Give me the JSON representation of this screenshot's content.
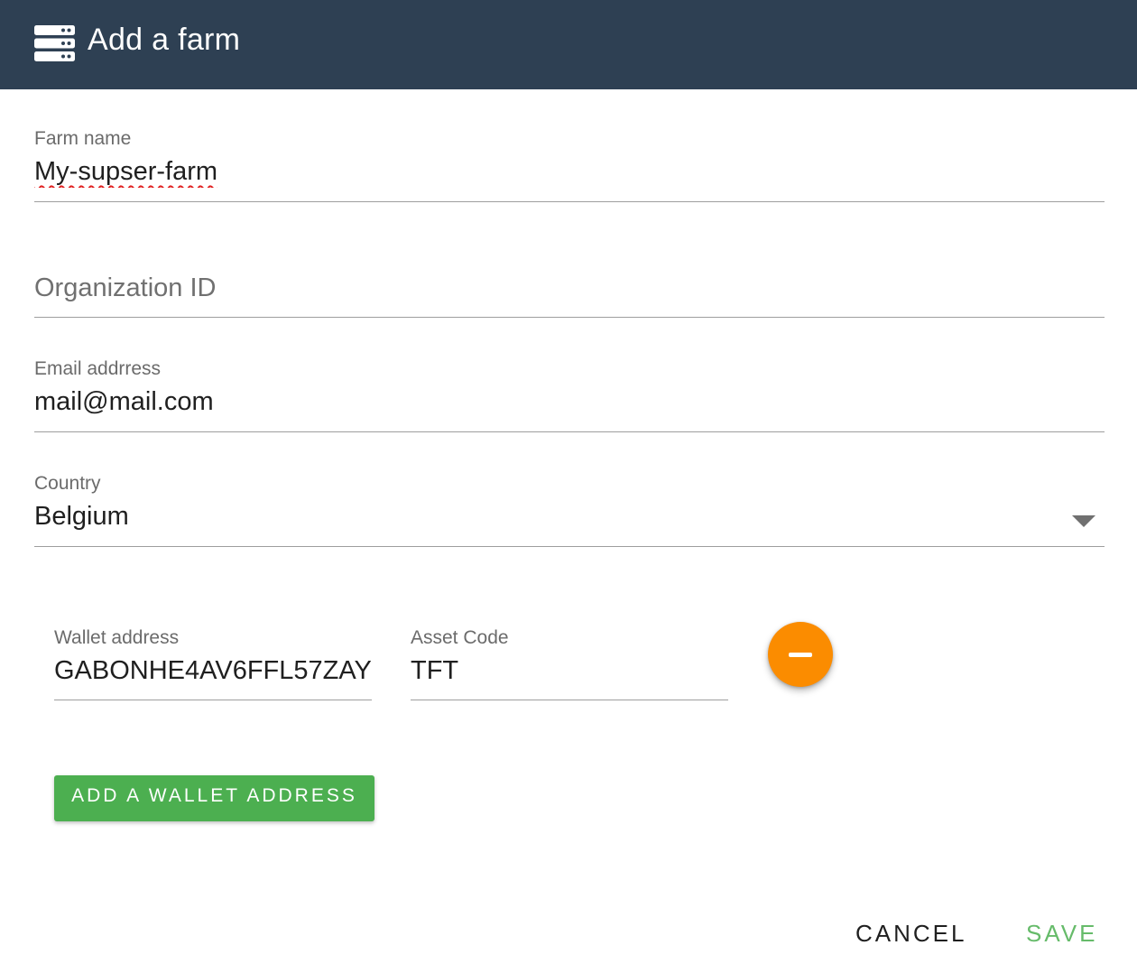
{
  "dialog": {
    "title": "Add a farm",
    "icon": "server-icon"
  },
  "form": {
    "farm_name": {
      "label": "Farm name",
      "value": "My-supser-farm"
    },
    "organization_id": {
      "placeholder": "Organization ID",
      "value": ""
    },
    "email": {
      "label": "Email addrress",
      "value": "mail@mail.com"
    },
    "country": {
      "label": "Country",
      "value": "Belgium"
    }
  },
  "wallets": [
    {
      "address_label": "Wallet address",
      "address_value": "GABONHE4AV6FFL57ZAY",
      "asset_label": "Asset Code",
      "asset_value": "TFT"
    }
  ],
  "buttons": {
    "add_wallet": "ADD A WALLET ADDRESS",
    "cancel": "CANCEL",
    "save": "SAVE",
    "remove_wallet_icon": "minus-icon"
  },
  "colors": {
    "header_bg": "#2e4053",
    "fab_orange": "#fb8c00",
    "add_button_green": "#4caf50",
    "save_green": "#66bb6a"
  }
}
